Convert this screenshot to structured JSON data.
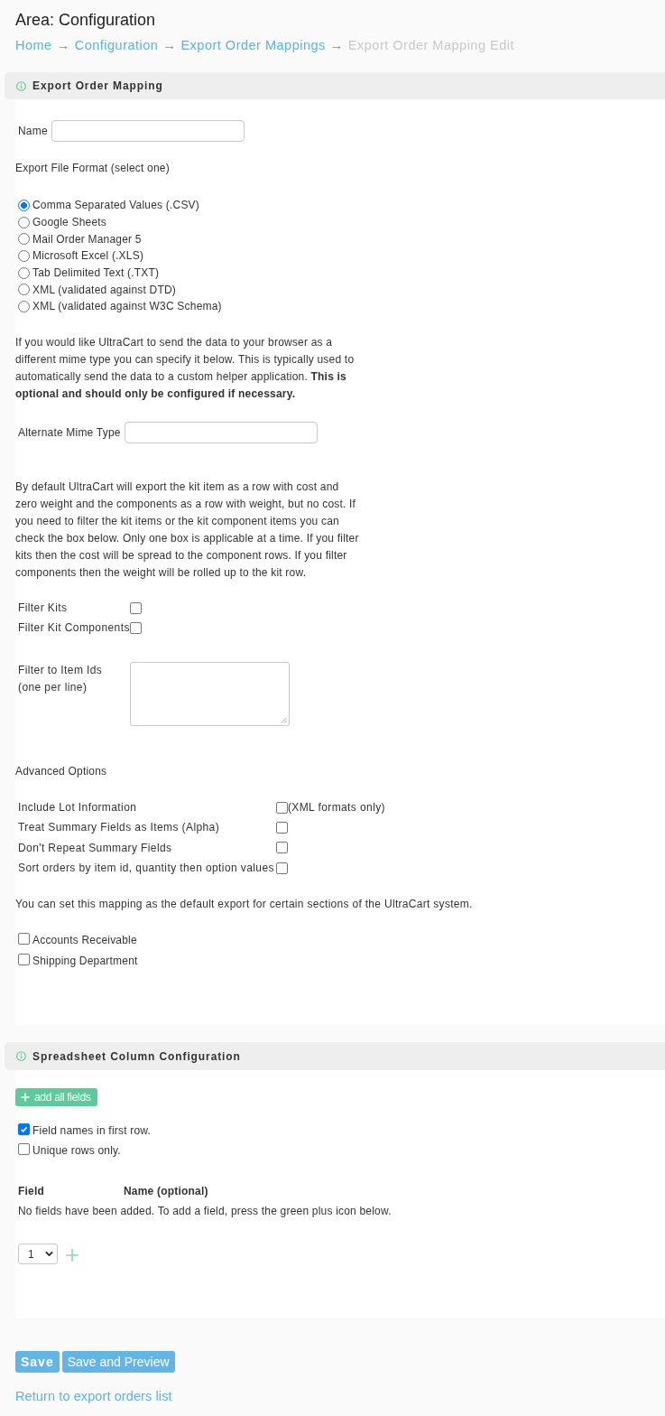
{
  "page": {
    "title": "Area: Configuration"
  },
  "breadcrumbs": {
    "separator": "→",
    "items": [
      {
        "label": "Home",
        "current": false
      },
      {
        "label": "Configuration",
        "current": false
      },
      {
        "label": "Export Order Mappings",
        "current": false
      },
      {
        "label": "Export Order Mapping Edit",
        "current": true
      }
    ]
  },
  "mapping_section": {
    "title": "Export Order Mapping",
    "name_field": {
      "label": "Name"
    },
    "format": {
      "label": "Export File Format (select one)",
      "options": [
        {
          "label": "Comma Separated Values (.CSV)",
          "selected": true
        },
        {
          "label": "Google Sheets",
          "selected": false
        },
        {
          "label": "Mail Order Manager 5",
          "selected": false
        },
        {
          "label": "Microsoft Excel (.XLS)",
          "selected": false
        },
        {
          "label": "Tab Delimited Text (.TXT)",
          "selected": false
        },
        {
          "label": "XML (validated against DTD)",
          "selected": false
        },
        {
          "label": "XML (validated against W3C Schema)",
          "selected": false
        }
      ]
    },
    "mime_note": "If you would like UltraCart to send the data to your browser as a different mime type you can specify it below. This is typically used to automatically send the data to a custom helper application. **This is optional and should only be configured if necessary.**",
    "mime_field": {
      "label": "Alternate Mime Type"
    },
    "kit_note": "By default UltraCart will export the kit item as a row with cost and zero weight and the components as a row with weight, but no cost. If you need to filter the kit items or the kit component items you can check the box below. Only one box is applicable at a time. If you filter kits then the cost will be spread to the component rows. If you filter components then the weight will be rolled up to the kit row.",
    "kit_filters": [
      {
        "label": "Filter Kits",
        "checked": false
      },
      {
        "label": "Filter Kit Components",
        "checked": false
      }
    ],
    "item_ids_field": {
      "label": "Filter to Item Ids",
      "hint": "(one per line)"
    },
    "advanced": {
      "title": "Advanced Options",
      "options": [
        {
          "label": "Include Lot Information",
          "checked": false,
          "note": "(XML formats only)"
        },
        {
          "label": "Treat Summary Fields as Items (Alpha)",
          "checked": false
        },
        {
          "label": "Don't Repeat Summary Fields",
          "checked": false
        },
        {
          "label": "Sort orders by item id, quantity then option values",
          "checked": false
        }
      ]
    },
    "default_note": "You can set this mapping as the default export for certain sections of the UltraCart system.",
    "default_sections": [
      {
        "label": "Accounts Receivable",
        "checked": false
      },
      {
        "label": "Shipping Department",
        "checked": false
      }
    ]
  },
  "columns_section": {
    "title": "Spreadsheet Column Configuration",
    "add_all_button": "add all fields",
    "options": [
      {
        "label": "Field names in first row.",
        "checked": true
      },
      {
        "label": "Unique rows only.",
        "checked": false
      }
    ],
    "table": {
      "columns": [
        "Field",
        "Name (optional)"
      ],
      "empty_message": "No fields have been added. To add a field, press the green plus icon below."
    },
    "count_select": {
      "value": "1"
    }
  },
  "actions": {
    "buttons": [
      {
        "label": "Save",
        "kind": "primary"
      },
      {
        "label": "Save and Preview",
        "kind": "secondary"
      }
    ],
    "link": "Return to export orders list"
  }
}
